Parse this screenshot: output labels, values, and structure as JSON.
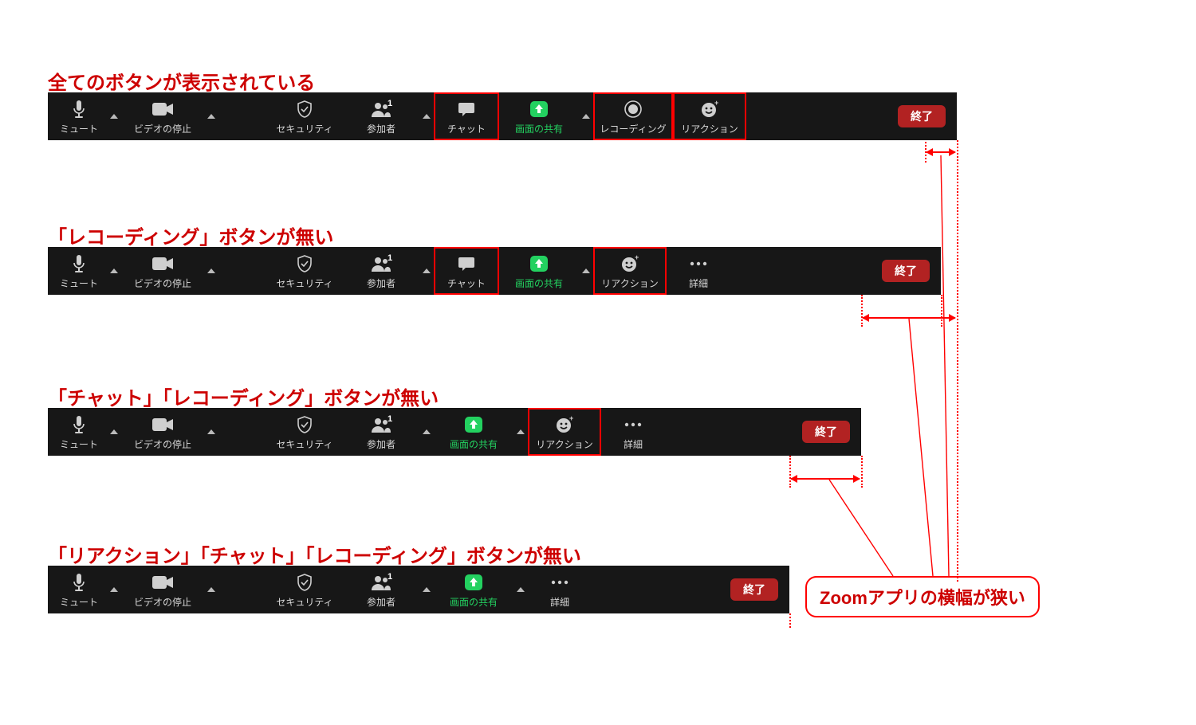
{
  "captions": {
    "c1": "全てのボタンが表示されている",
    "c2": "「レコーディング」ボタンが無い",
    "c3": "「チャット」「レコーディング」ボタンが無い",
    "c4": "「リアクション」「チャット」「レコーディング」ボタンが無い"
  },
  "annotation": {
    "box": "Zoomアプリの横幅が狭い"
  },
  "buttons": {
    "mute": "ミュート",
    "video_stop": "ビデオの停止",
    "security": "セキュリティ",
    "participants": "参加者",
    "participants_count": "1",
    "chat": "チャット",
    "share": "画面の共有",
    "record": "レコーディング",
    "reaction": "リアクション",
    "more": "詳細",
    "end": "終了"
  }
}
